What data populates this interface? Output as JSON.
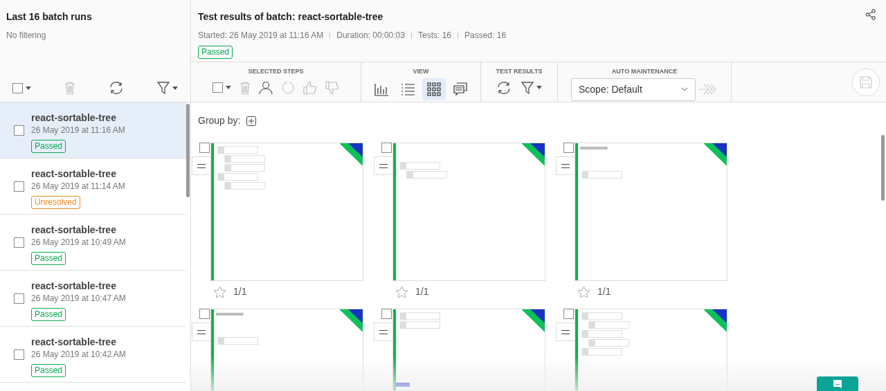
{
  "batch_list": {
    "title": "Last 16 batch runs",
    "filter": "No filtering",
    "select_all": {
      "checked": false
    },
    "items": [
      {
        "name": "react-sortable-tree",
        "date": "26 May 2019 at 11:16 AM",
        "status": "Passed",
        "kind": "passed",
        "selected": true,
        "checked": false
      },
      {
        "name": "react-sortable-tree",
        "date": "26 May 2019 at 11:14 AM",
        "status": "Unresolved",
        "kind": "unresolved",
        "selected": false,
        "checked": false
      },
      {
        "name": "react-sortable-tree",
        "date": "26 May 2019 at 10:49 AM",
        "status": "Passed",
        "kind": "passed",
        "selected": false,
        "checked": false
      },
      {
        "name": "react-sortable-tree",
        "date": "26 May 2019 at 10:47 AM",
        "status": "Passed",
        "kind": "passed",
        "selected": false,
        "checked": false
      },
      {
        "name": "react-sortable-tree",
        "date": "26 May 2019 at 10:42 AM",
        "status": "Passed",
        "kind": "passed",
        "selected": false,
        "checked": false
      }
    ]
  },
  "header": {
    "title": "Test results of batch: react-sortable-tree",
    "meta": [
      "Started: 26 May 2019 at 11:16 AM",
      "Duration: 00:00:03",
      "Tests: 16",
      "Passed: 16"
    ],
    "status": "Passed"
  },
  "toolbar": {
    "groups": [
      "SELECTED STEPS",
      "VIEW",
      "TEST RESULTS",
      "AUTO MAINTENANCE"
    ],
    "views": [
      {
        "kind": "chart",
        "selected": false
      },
      {
        "kind": "list",
        "selected": false
      },
      {
        "kind": "grid",
        "selected": true
      },
      {
        "kind": "comments",
        "selected": false
      }
    ],
    "select_steps": {
      "checked": false
    },
    "scope": "Scope: Default"
  },
  "group_by": "Group by:",
  "cards": [
    {
      "checked": false,
      "score": "1/1",
      "starred": false
    },
    {
      "checked": false,
      "score": "1/1",
      "starred": false
    },
    {
      "checked": false,
      "score": "1/1",
      "starred": false
    },
    {
      "checked": false
    },
    {
      "checked": false
    },
    {
      "checked": false
    }
  ]
}
